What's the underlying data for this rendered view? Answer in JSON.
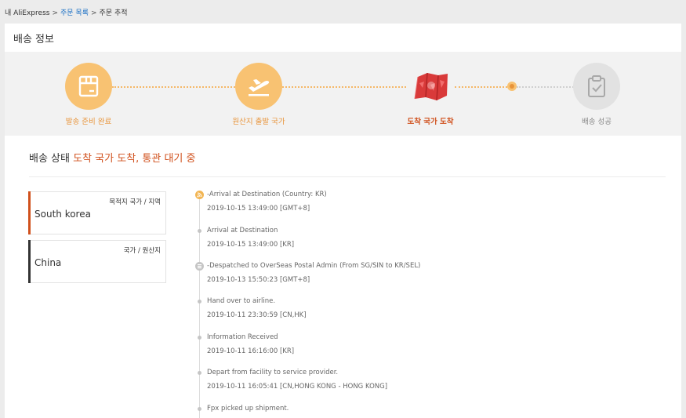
{
  "breadcrumb": {
    "home": "내 AliExpress",
    "separator": ">",
    "orders": "주문 목록",
    "current": "주문 추적"
  },
  "section_title": "배송 정보",
  "steps": [
    {
      "label": "발송 준비 완료",
      "icon": "package-icon",
      "state": "done"
    },
    {
      "label": "원산지 출발 국가",
      "icon": "airplane-takeoff-icon",
      "state": "done"
    },
    {
      "label": "도착 국가 도착",
      "icon": "destination-map-icon",
      "state": "current"
    },
    {
      "label": "배송 성공",
      "icon": "clipboard-check-icon",
      "state": "todo"
    }
  ],
  "status": {
    "label": "배송 상태",
    "value": "도착 국가 도착, 통관 대기 중"
  },
  "destination": {
    "heading": "목적지 국가 / 지역",
    "value": "South korea"
  },
  "origin": {
    "heading": "국가 / 원산지",
    "value": "China"
  },
  "events": [
    {
      "title": "-Arrival at Destination (Country: KR)",
      "time": "2019-10-15 13:49:00 [GMT+8]",
      "marker": "orange"
    },
    {
      "title": "Arrival at Destination",
      "time": "2019-10-15 13:49:00 [KR]",
      "marker": "dot"
    },
    {
      "title": "-Despatched to OverSeas Postal Admin (From SG/SIN to KR/SEL)",
      "time": "2019-10-13 15:50:23 [GMT+8]",
      "marker": "grey"
    },
    {
      "title": "Hand over to airline.",
      "time": "2019-10-11 23:30:59 [CN,HK]",
      "marker": "dot"
    },
    {
      "title": "Information Received",
      "time": "2019-10-11 16:16:00 [KR]",
      "marker": "dot"
    },
    {
      "title": "Depart from facility to service provider.",
      "time": "2019-10-11 16:05:41 [CN,HONG KONG - HONG KONG]",
      "marker": "dot"
    },
    {
      "title": "Fpx picked up shipment.",
      "time": "",
      "marker": "dot"
    }
  ],
  "colors": {
    "accent": "#d0501c",
    "step_done": "#f8c272",
    "link": "#1a6fc4"
  }
}
